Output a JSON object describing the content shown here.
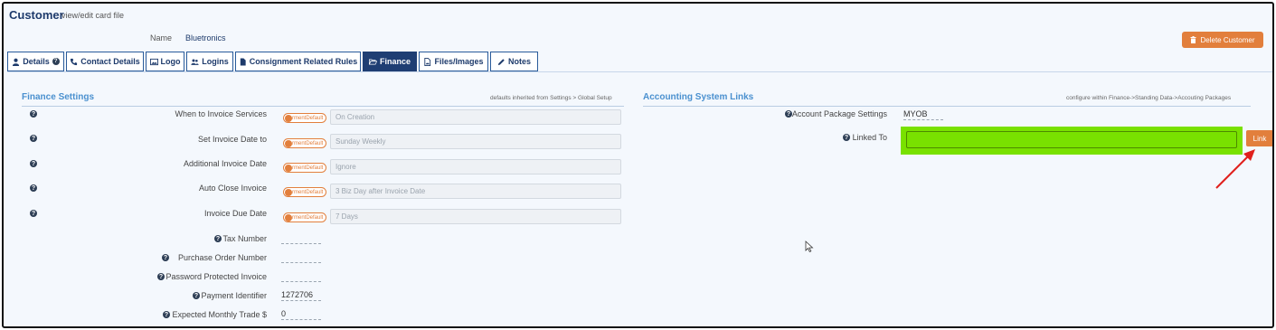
{
  "header": {
    "title": "Customer",
    "subtitle": "view/edit card file"
  },
  "customer": {
    "name_label": "Name",
    "name_value": "Bluetronics"
  },
  "actions": {
    "delete_label": "Delete Customer"
  },
  "tabs": [
    {
      "label": "Details",
      "icon": "user-icon"
    },
    {
      "label": "Contact Details",
      "icon": "phone-icon"
    },
    {
      "label": "Logo",
      "icon": "image-icon"
    },
    {
      "label": "Logins",
      "icon": "users-icon"
    },
    {
      "label": "Consignment Related Rules",
      "icon": "file-icon"
    },
    {
      "label": "Finance",
      "icon": "folder-open-icon",
      "active": true
    },
    {
      "label": "Files/Images",
      "icon": "file-image-icon"
    },
    {
      "label": "Notes",
      "icon": "pencil-icon"
    }
  ],
  "finance": {
    "title": "Finance Settings",
    "note": "defaults inherited from Settings > Global Setup",
    "toggle_text": "rmentDefault",
    "settings": [
      {
        "label": "When to Invoice Services",
        "value": "On Creation"
      },
      {
        "label": "Set Invoice Date to",
        "value": "Sunday Weekly"
      },
      {
        "label": "Additional Invoice Date",
        "value": "Ignore"
      },
      {
        "label": "Auto Close Invoice",
        "value": "3 Biz Day after Invoice Date"
      },
      {
        "label": "Invoice Due Date",
        "value": "7 Days"
      }
    ],
    "fields": [
      {
        "label": "Tax Number",
        "value": ""
      },
      {
        "label": "Purchase Order Number",
        "value": ""
      },
      {
        "label": "Password Protected Invoice",
        "value": ""
      },
      {
        "label": "Payment Identifier",
        "value": "1272706"
      },
      {
        "label": "Expected Monthly Trade $",
        "value": "0"
      }
    ]
  },
  "accounting": {
    "title": "Accounting System Links",
    "note": "configure within Finance->Standing Data->Accouting Packages",
    "package_label": "Account Package Settings",
    "package_value": "MYOB",
    "linked_label": "Linked To",
    "linked_value": "",
    "link_button": "Link"
  },
  "colors": {
    "accent": "#e27f3c",
    "active_tab": "#1f3e73",
    "section_title": "#4a90cf",
    "highlight": "#79e100",
    "arrow": "#e0201c"
  }
}
